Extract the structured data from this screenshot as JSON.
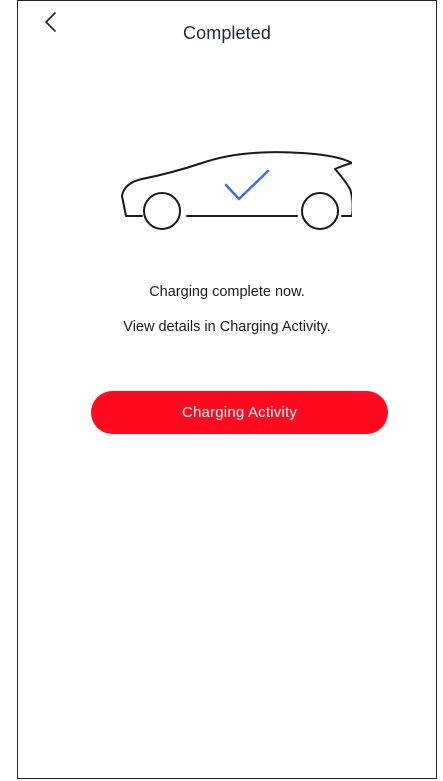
{
  "header": {
    "back_icon": "chevron-left-icon",
    "title": "Completed"
  },
  "illustration": {
    "icon": "car-check-icon",
    "check_color": "#3a6fe6",
    "outline_color": "#1a1a1a"
  },
  "content": {
    "line1": "Charging complete now.",
    "line2": "View details in Charging Activity."
  },
  "cta": {
    "label": "Charging Activity",
    "color": "#ff0a1e"
  }
}
